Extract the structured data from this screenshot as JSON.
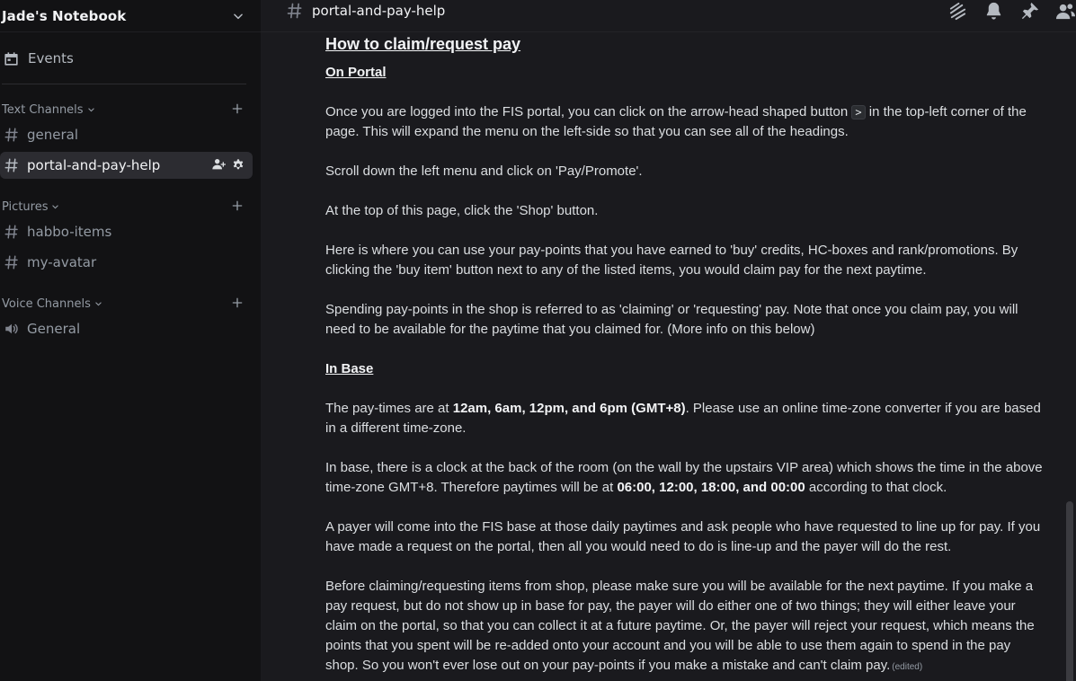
{
  "server": {
    "name": "Jade's Notebook"
  },
  "sidebar": {
    "events_label": "Events",
    "categories": [
      {
        "label": "Text Channels"
      },
      {
        "label": "Pictures"
      },
      {
        "label": "Voice Channels"
      }
    ],
    "channels": {
      "general": "general",
      "portal": "portal-and-pay-help",
      "habbo": "habbo-items",
      "avatar": "my-avatar",
      "voice_general": "General"
    }
  },
  "topbar": {
    "channel": "portal-and-pay-help"
  },
  "message": {
    "heading": "How to claim/request pay",
    "sub1": "On Portal",
    "p1_a": "Once you are logged into the FIS portal, you can click on the arrow-head shaped button ",
    "p1_code": ">",
    "p1_b": " in the top-left corner of the page. This will expand the menu on the left-side so that you can see all of the headings.",
    "p2": "Scroll down the left menu and click on 'Pay/Promote'.",
    "p3": "At the top of this page, click the 'Shop' button.",
    "p4": "Here is where you can use your pay-points that you have earned to 'buy' credits, HC-boxes and rank/promotions. By clicking the 'buy item' button next to any of the listed items, you would claim pay for the next paytime.",
    "p5": "Spending pay-points in the shop is referred to as 'claiming' or 'requesting' pay. Note that once you claim pay, you will need to be available for the paytime that you claimed for. (More info on this below)",
    "sub2": "In Base",
    "p6_a": "The pay-times are at ",
    "p6_b": "12am, 6am, 12pm, and 6pm (GMT+8)",
    "p6_c": ". Please use an online time-zone converter if you are based in a different time-zone.",
    "p7_a": "In base, there is a clock at the back of the room (on the wall by the upstairs VIP area) which shows the time in the above time-zone GMT+8. Therefore paytimes will be at ",
    "p7_b": "06:00, 12:00, 18:00, and 00:00",
    "p7_c": " according to that clock.",
    "p8": "A payer will come into the FIS base at those daily paytimes and ask people who have requested to line up for pay. If you have made a request on the portal, then all you would need to do is line-up and the payer will do the rest.",
    "p9": "Before claiming/requesting items from shop, please make sure you will be available for the next paytime. If you make a pay request, but do not show up in base for pay, the payer will do either one of two things; they will either leave your claim on the portal, so that you can collect it at a future paytime. Or, the payer will reject your request, which means the points that you spent will be re-added onto your account and you will be able to use them again to spend in the pay shop. So you won't ever lose out on your pay-points if you make a mistake and can't claim pay.",
    "edited": "(edited)"
  }
}
